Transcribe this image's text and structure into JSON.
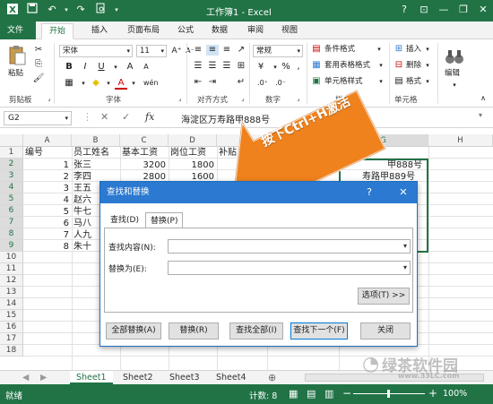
{
  "titlebar": {
    "title": "工作簿1 - Excel",
    "help": "?",
    "min": "—",
    "restore": "❐",
    "close": "✕"
  },
  "tabs": [
    "文件",
    "开始",
    "插入",
    "页面布局",
    "公式",
    "数据",
    "审阅",
    "视图"
  ],
  "ribbon": {
    "paste": "粘贴",
    "clipboard": "剪贴板",
    "font_name": "宋体",
    "font_size": "11",
    "font_group": "字体",
    "align_group": "对齐方式",
    "number_format": "常规",
    "number_group": "数字",
    "cond_format": "条件格式",
    "table_format": "套用表格格式",
    "cell_style": "单元格样式",
    "style_group": "样式",
    "insert": "插入",
    "delete": "删除",
    "format": "格式",
    "cells_group": "单元格",
    "edit": "编辑",
    "bold": "B",
    "italic": "I",
    "underline": "U",
    "font_color": "A",
    "percent": "%",
    "comma": ","
  },
  "formula_bar": {
    "cell_ref": "G2",
    "fx": "fx",
    "cancel": "✕",
    "confirm": "✓",
    "content": "海淀区万寿路甲888号"
  },
  "columns": [
    "A",
    "B",
    "C",
    "D",
    "E",
    "F",
    "G",
    "H"
  ],
  "rows": [
    "1",
    "2",
    "3",
    "4",
    "5",
    "6",
    "7",
    "8",
    "9",
    "10",
    "11",
    "12",
    "13",
    "14",
    "15",
    "16",
    "17",
    "18"
  ],
  "sheet": {
    "headers": [
      "编号",
      "员工姓名",
      "基本工资",
      "岗位工资",
      "补贴"
    ],
    "ids": [
      "1",
      "2",
      "3",
      "4",
      "5",
      "6",
      "7",
      "8"
    ],
    "names": [
      "张三",
      "李四",
      "王五",
      "赵六",
      "牛七",
      "马八",
      "人九",
      "朱十"
    ],
    "base_salary": [
      "3200",
      "2800"
    ],
    "post_salary": [
      "1800",
      "1600"
    ],
    "g_col": [
      "甲888号",
      "寿路甲889号"
    ]
  },
  "sheet_tabs": [
    "Sheet1",
    "Sheet2",
    "Sheet3",
    "Sheet4"
  ],
  "sheet_nav": {
    "prev": "◀",
    "next": "▶",
    "add": "⊕"
  },
  "status": {
    "ready": "就绪",
    "count": "计数: 8",
    "zoom": "100%",
    "zoom_minus": "−",
    "zoom_plus": "+"
  },
  "callout": {
    "text": "按下Ctrl+H激活",
    "color": "#f0821e"
  },
  "dialog": {
    "title": "查找和替换",
    "help": "?",
    "close": "✕",
    "tab_find": "查找(D)",
    "tab_replace": "替换(P)",
    "find_label": "查找内容(N):",
    "replace_label": "替换为(E):",
    "options": "选项(T) >>",
    "btn_replace_all": "全部替换(A)",
    "btn_replace": "替换(R)",
    "btn_find_all": "查找全部(I)",
    "btn_find_next": "查找下一个(F)",
    "btn_close": "关闭"
  },
  "watermark": {
    "brand": "绿茶软件园",
    "url": "www.33LC.com"
  },
  "colors": {
    "excel_green": "#217346",
    "dialog_blue": "#2b79d0"
  }
}
